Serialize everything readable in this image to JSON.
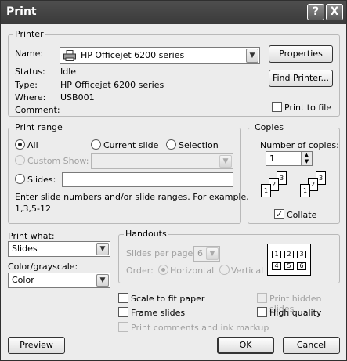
{
  "window": {
    "title": "Print",
    "help_btn": "?",
    "close_btn": "X"
  },
  "printer": {
    "group_label": "Printer",
    "name_label": "Name:",
    "name_value": "HP Officejet 6200 series",
    "status_label": "Status:",
    "status_value": "Idle",
    "type_label": "Type:",
    "type_value": "HP Officejet 6200 series",
    "where_label": "Where:",
    "where_value": "USB001",
    "comment_label": "Comment:",
    "comment_value": "",
    "properties_btn": "Properties",
    "find_printer_btn": "Find Printer...",
    "print_to_file_label": "Print to file",
    "print_to_file_checked": false
  },
  "print_range": {
    "group_label": "Print range",
    "all_label": "All",
    "current_slide_label": "Current slide",
    "selection_label": "Selection",
    "custom_show_label": "Custom Show:",
    "slides_label": "Slides:",
    "hint": "Enter slide numbers and/or slide ranges. For example,",
    "hint2": "1,3,5-12",
    "selected": "All"
  },
  "copies": {
    "group_label": "Copies",
    "number_label": "Number of copies:",
    "number_value": "1",
    "collate_label": "Collate",
    "collate_checked": true,
    "pages": [
      "1",
      "2",
      "3"
    ]
  },
  "print_what": {
    "label": "Print what:",
    "value": "Slides"
  },
  "color": {
    "label": "Color/grayscale:",
    "value": "Color"
  },
  "handouts": {
    "group_label": "Handouts",
    "slides_per_page_label": "Slides per page:",
    "slides_per_page_value": "6",
    "order_label": "Order:",
    "horizontal_label": "Horizontal",
    "vertical_label": "Vertical",
    "preview_cells": [
      "1",
      "2",
      "3",
      "4",
      "5",
      "6"
    ]
  },
  "options": {
    "scale_to_fit": "Scale to fit paper",
    "frame_slides": "Frame slides",
    "print_comments": "Print comments and ink markup",
    "print_hidden": "Print hidden slides",
    "high_quality": "High quality"
  },
  "buttons": {
    "preview": "Preview",
    "ok": "OK",
    "cancel": "Cancel"
  }
}
